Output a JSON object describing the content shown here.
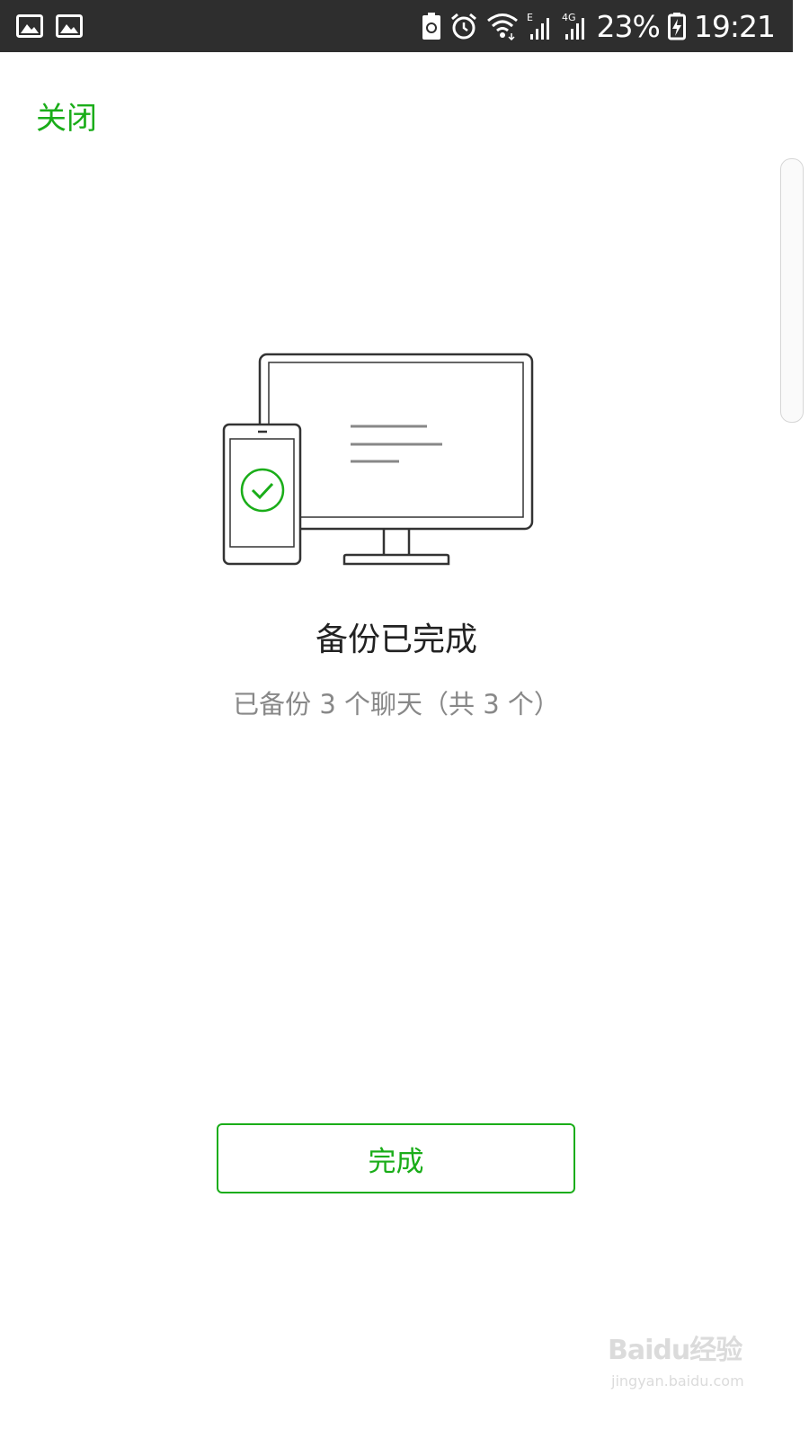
{
  "status_bar": {
    "battery_percent": "23%",
    "time": "19:21",
    "icons": [
      "image-icon",
      "image-icon",
      "battery-saver-icon",
      "alarm-icon",
      "wifi-icon",
      "signal-e-icon",
      "signal-4g-icon",
      "battery-charging-icon"
    ]
  },
  "header": {
    "close_label": "关闭"
  },
  "main": {
    "title": "备份已完成",
    "subtitle": "已备份 3 个聊天（共 3 个）"
  },
  "footer": {
    "done_label": "完成"
  },
  "watermark": {
    "brand": "Baidu经验",
    "url": "jingyan.baidu.com"
  },
  "colors": {
    "accent": "#1aad19",
    "status_bar": "#2e2e2e",
    "title": "#222222",
    "subtitle": "#888888"
  }
}
